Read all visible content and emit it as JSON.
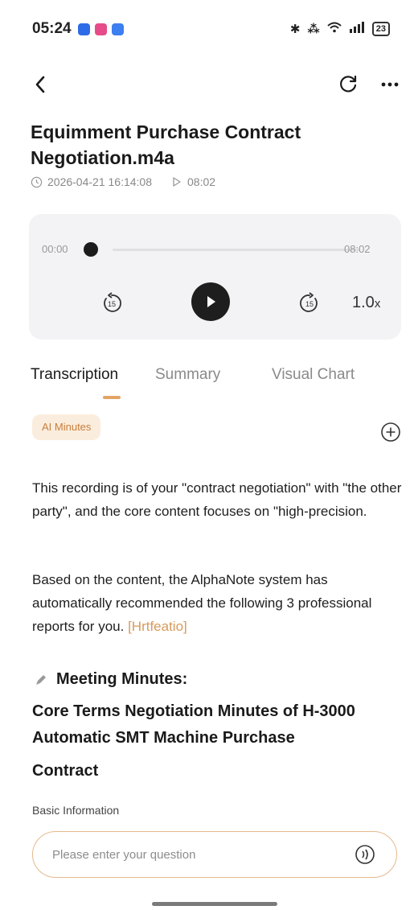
{
  "status_bar": {
    "time": "05:24",
    "battery": "23"
  },
  "recording": {
    "title": "Equimment Purchase Contract Negotiation.m4a",
    "datetime": "2026-04-21 16:14:08",
    "duration": "08:02"
  },
  "player": {
    "current_time": "00:00",
    "total_time": "08:02",
    "progress": 0,
    "skip_back_seconds": "15",
    "skip_forward_seconds": "15",
    "speed_value": "1.0",
    "speed_suffix": "x"
  },
  "tabs": [
    {
      "label": "Transcription",
      "active": true
    },
    {
      "label": "Summary",
      "active": false
    },
    {
      "label": "Visual Chart",
      "active": false
    }
  ],
  "ai_chip": "AI Minutes",
  "content": {
    "intro": "This recording is of your \"contract negotiation\" with \"the other party\", and the core content focuses on \"high-precision.",
    "recommend": "Based on the content, the AlphaNote system has automatically recommended the following 3 professional reports for you.",
    "recommend_link": "[Hrtfeatio]",
    "minutes_heading": "Meeting Minutes:",
    "minutes_title": "Core Terms Negotiation Minutes of H-3000 Automatic SMT Machine Purchase",
    "minutes_title_last": "Contract",
    "basic_info": "Basic Information"
  },
  "question": {
    "placeholder": "Please enter your question"
  },
  "colors": {
    "accent": "#e3a466",
    "chip_bg": "#fbeddd",
    "chip_text": "#c77e3c",
    "link": "#d79a5b"
  }
}
